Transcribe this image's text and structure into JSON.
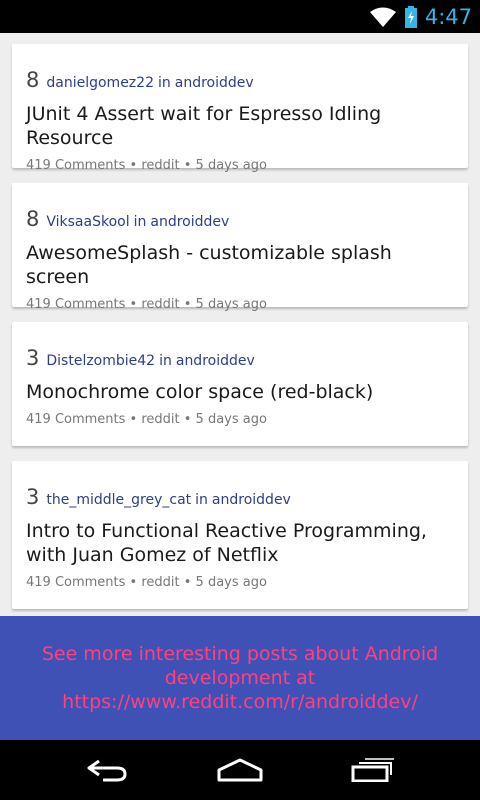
{
  "status_bar": {
    "time": "4:47",
    "icons": [
      "wifi-icon",
      "battery-charging-icon"
    ],
    "clock_color": "#33b5e5"
  },
  "posts": [
    {
      "score": "8",
      "author": "danielgomez22",
      "in_word": "in",
      "subreddit": "androiddev",
      "title": "JUnit 4 Assert wait for Espresso Idling Resource",
      "info": "419 Comments • reddit • 5 days ago"
    },
    {
      "score": "8",
      "author": "ViksaaSkool",
      "in_word": "in",
      "subreddit": "androiddev",
      "title": "AwesomeSplash - customizable splash screen",
      "info": "419 Comments • reddit • 5 days ago"
    },
    {
      "score": "3",
      "author": "Distelzombie42",
      "in_word": "in",
      "subreddit": "androiddev",
      "title": "Monochrome color space (red-black)",
      "info": "419 Comments • reddit • 5 days ago"
    },
    {
      "score": "3",
      "author": "the_middle_grey_cat",
      "in_word": "in",
      "subreddit": "androiddev",
      "title": "Intro to Functional Reactive Programming, with Juan Gomez of Netflix",
      "info": "419 Comments • reddit • 5 days ago"
    }
  ],
  "banner": {
    "text": "See more interesting posts about Android development at https://www.reddit.com/r/androiddev/"
  },
  "colors": {
    "banner_bg": "#3f51b5",
    "banner_text": "#ff4081",
    "author_text": "#2d3e8a"
  },
  "nav_bar": {
    "icons": [
      "back-icon",
      "home-icon",
      "recent-apps-icon"
    ]
  }
}
